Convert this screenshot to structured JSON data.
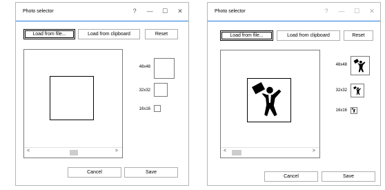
{
  "windows": [
    {
      "title": "Photo selector",
      "titlebar": {
        "help": "?",
        "minimize": "—",
        "maximize": "☐",
        "close": "✕"
      },
      "toolbar": {
        "load_file": "Load from file...",
        "load_clipboard": "Load from clipboard",
        "reset": "Reset"
      },
      "sizes": [
        "48x48",
        "32x32",
        "16x16"
      ],
      "scroll": {
        "left": "<",
        "right": ">"
      },
      "actions": {
        "cancel": "Cancel",
        "save": "Save"
      },
      "has_image": false
    },
    {
      "title": "Photo selector",
      "titlebar": {
        "help": "?",
        "minimize": "—",
        "maximize": "☐",
        "close": "✕"
      },
      "toolbar": {
        "load_file": "Load from file...",
        "load_clipboard": "Load from clipboard",
        "reset": "Reset"
      },
      "sizes": [
        "48x48",
        "32x32",
        "16x16"
      ],
      "scroll": {
        "left": "<",
        "right": ">"
      },
      "actions": {
        "cancel": "Cancel",
        "save": "Save"
      },
      "has_image": true
    }
  ],
  "icons": {
    "figure": "businessman-briefcase-icon"
  },
  "colors": {
    "accent": "#1d79d6",
    "border": "#adadad"
  }
}
